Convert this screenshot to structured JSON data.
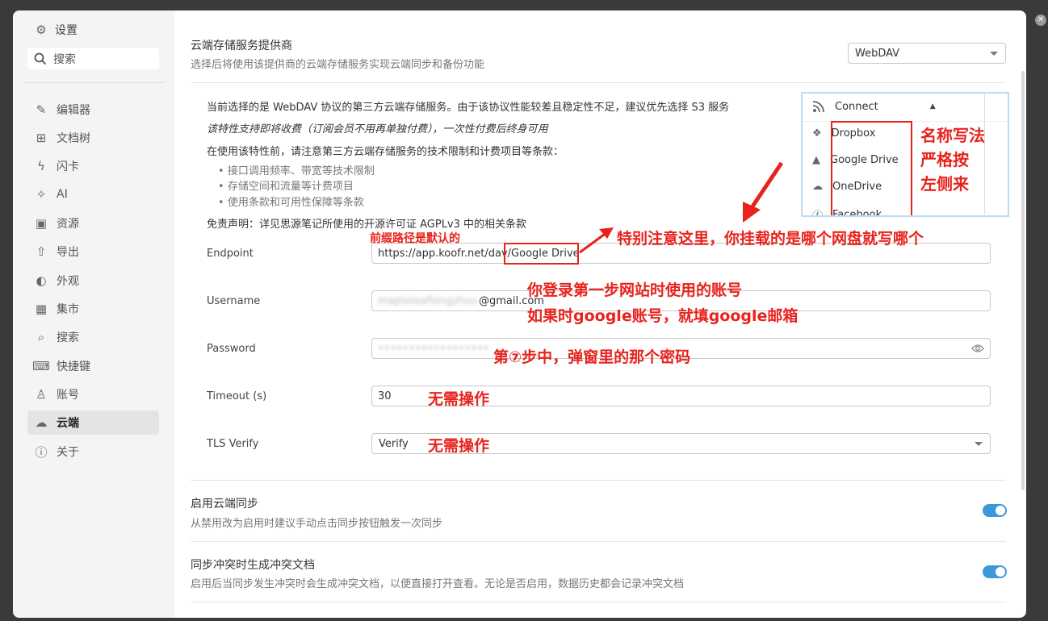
{
  "sidebar": {
    "header": "设置",
    "search": "搜索",
    "items": [
      {
        "label": "编辑器",
        "icon": "pen-icon"
      },
      {
        "label": "文档树",
        "icon": "tree-icon"
      },
      {
        "label": "闪卡",
        "icon": "flash-icon"
      },
      {
        "label": "AI",
        "icon": "sparkle-icon"
      },
      {
        "label": "资源",
        "icon": "image-icon"
      },
      {
        "label": "导出",
        "icon": "export-icon"
      },
      {
        "label": "外观",
        "icon": "palette-icon"
      },
      {
        "label": "集市",
        "icon": "store-icon"
      },
      {
        "label": "搜索",
        "icon": "search-icon"
      },
      {
        "label": "快捷键",
        "icon": "keyboard-icon"
      },
      {
        "label": "账号",
        "icon": "user-icon"
      },
      {
        "label": "云端",
        "icon": "cloud-icon"
      },
      {
        "label": "关于",
        "icon": "info-icon"
      }
    ]
  },
  "provider": {
    "title": "云端存储服务提供商",
    "desc": "选择后将使用该提供商的云端存储服务实现云端同步和备份功能",
    "value": "WebDAV"
  },
  "notice": {
    "line1": "当前选择的是 WebDAV 协议的第三方云端存储服务。由于该协议性能较差且稳定性不足，建议优先选择 S3 服务",
    "line2": "该特性支持即将收费（订阅会员不用再单独付费），一次性付费后终身可用",
    "line3": "在使用该特性前，请注意第三方云端存储服务的技术限制和计费项目等条款：",
    "bullets": [
      "接口调用频率、带宽等技术限制",
      "存储空间和流量等计费项目",
      "使用条款和可用性保障等条款"
    ],
    "disclaimer": "免责声明：详见思源笔记所使用的开源许可证 AGPLv3 中的相关条款"
  },
  "fields": {
    "endpoint_label": "Endpoint",
    "endpoint_prefix": "https://app.koofr.net/dav/",
    "endpoint_suffix": "Google Drive",
    "username_label": "Username",
    "username_hidden": "mapleleaflongzhou",
    "username_domain": "@gmail.com",
    "password_label": "Password",
    "password_hidden": "••••••••••••••••••",
    "timeout_label": "Timeout (s)",
    "timeout_value": "30",
    "tls_label": "TLS Verify",
    "tls_value": "Verify"
  },
  "sync": {
    "title": "启用云端同步",
    "desc": "从禁用改为启用时建议手动点击同步按钮触发一次同步",
    "enabled": true
  },
  "conflict": {
    "title": "同步冲突时生成冲突文档",
    "desc": "启用后当同步发生冲突时会生成冲突文档，以便直接打开查看。无论是否启用，数据历史都会记录冲突文档",
    "enabled": true
  },
  "dropdown": {
    "header": "Connect",
    "items": [
      {
        "label": "Dropbox",
        "icon": "dropbox-icon"
      },
      {
        "label": "Google Drive",
        "icon": "google-drive-icon"
      },
      {
        "label": "OneDrive",
        "icon": "onedrive-icon"
      },
      {
        "label": "Facebook",
        "icon": "facebook-icon"
      }
    ]
  },
  "annotations": {
    "prefix_note": "前缀路径是默认的",
    "endpoint_note": "特别注意这里，你挂载的是哪个网盘就写哪个",
    "name_note_1": "名称写法",
    "name_note_2": "严格按",
    "name_note_3": "左侧来",
    "username_note_1": "你登录第一步网站时使用的账号",
    "username_note_2": "如果时google账号，就填google邮箱",
    "password_note": "第⑦步中，弹窗里的那个密码",
    "timeout_note": "无需操作",
    "tls_note": "无需操作"
  },
  "colors": {
    "accent": "#3a9ad9",
    "annotation": "#e8231d"
  }
}
